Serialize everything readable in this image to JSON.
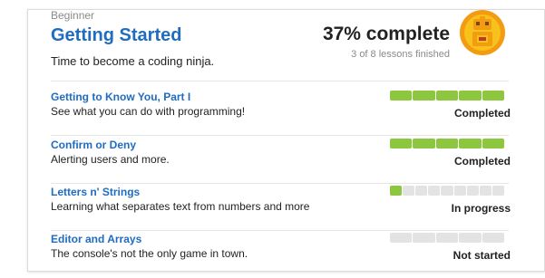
{
  "course": {
    "level": "Beginner",
    "title": "Getting Started",
    "tagline": "Time to become a coding ninja.",
    "progress_text": "37% complete",
    "progress_sub": "3 of 8 lessons finished",
    "progress_fraction": 0.375,
    "badge_icon": "robot-badge-icon"
  },
  "colors": {
    "link": "#1f6cc0",
    "progress_on": "#8dc63f",
    "progress_off": "#e3e3e3",
    "badge_orange": "#f39c12",
    "badge_yellow": "#f7c21b"
  },
  "lessons": [
    {
      "title": "Getting to Know You, Part I",
      "description": "See what you can do with programming!",
      "status": "Completed",
      "progress_fraction": 1.0
    },
    {
      "title": "Confirm or Deny",
      "description": "Alerting users and more.",
      "status": "Completed",
      "progress_fraction": 1.0
    },
    {
      "title": "Letters n' Strings",
      "description": "Learning what separates text from numbers and more",
      "status": "In progress",
      "progress_fraction": 0.1
    },
    {
      "title": "Editor and Arrays",
      "description": "The console's not the only game in town.",
      "status": "Not started",
      "progress_fraction": 0.0
    }
  ]
}
